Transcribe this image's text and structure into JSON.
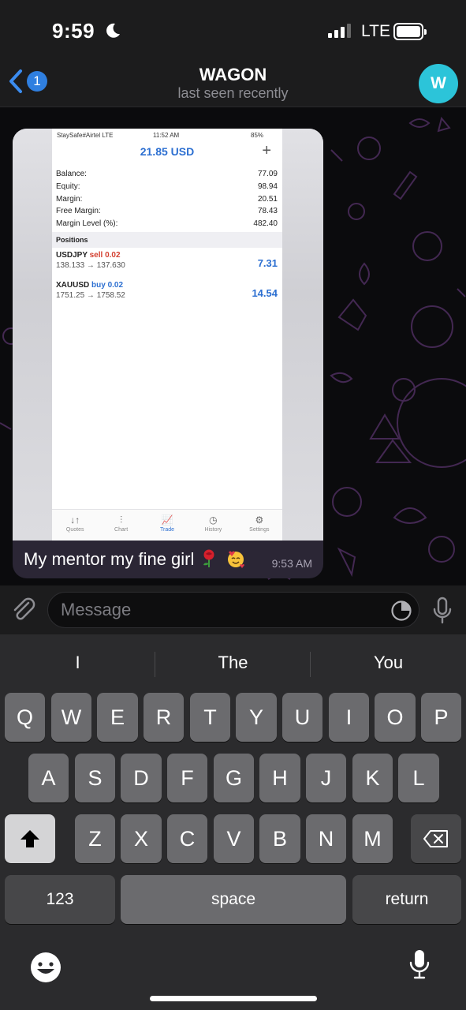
{
  "status_bar": {
    "time": "9:59",
    "network": "LTE",
    "icons": [
      "moon-icon",
      "signal-icon",
      "battery-icon"
    ]
  },
  "header": {
    "back_badge": "1",
    "title": "WAGON",
    "subtitle": "last seen recently",
    "avatar_letter": "W"
  },
  "message": {
    "caption": "My mentor my fine girl",
    "emojis": [
      "rose",
      "smiling-face-with-hearts"
    ],
    "time": "9:53 AM",
    "screenshot": {
      "status_left": "StaySafe#Airtel  LTE",
      "status_time": "11:52 AM",
      "status_battery": "85%",
      "title": "21.85 USD",
      "plus": "+",
      "account": [
        {
          "label": "Balance:",
          "value": "77.09"
        },
        {
          "label": "Equity:",
          "value": "98.94"
        },
        {
          "label": "Margin:",
          "value": "20.51"
        },
        {
          "label": "Free Margin:",
          "value": "78.43"
        },
        {
          "label": "Margin Level (%):",
          "value": "482.40"
        }
      ],
      "positions_header": "Positions",
      "positions": [
        {
          "symbol": "USDJPY",
          "direction": "sell 0.02",
          "prices": "138.133 → 137.630",
          "profit": "7.31"
        },
        {
          "symbol": "XAUUSD",
          "direction": "buy 0.02",
          "prices": "1751.25 → 1758.52",
          "profit": "14.54"
        }
      ],
      "tabs": [
        {
          "label": "Quotes",
          "icon": "↓↑"
        },
        {
          "label": "Chart",
          "icon": "⫶"
        },
        {
          "label": "Trade",
          "icon": "📈"
        },
        {
          "label": "History",
          "icon": "◷"
        },
        {
          "label": "Settings",
          "icon": "⚙"
        }
      ]
    }
  },
  "composer": {
    "placeholder": "Message"
  },
  "keyboard": {
    "suggestions": [
      "I",
      "The",
      "You"
    ],
    "row1": [
      "Q",
      "W",
      "E",
      "R",
      "T",
      "Y",
      "U",
      "I",
      "O",
      "P"
    ],
    "row2": [
      "A",
      "S",
      "D",
      "F",
      "G",
      "H",
      "J",
      "K",
      "L"
    ],
    "row3": [
      "Z",
      "X",
      "C",
      "V",
      "B",
      "N",
      "M"
    ],
    "numbers_label": "123",
    "space_label": "space",
    "return_label": "return"
  },
  "colors": {
    "accent": "#2f7fe0",
    "avatar": "#2cc4d9",
    "bubble": "#2b2635",
    "keyboard": "#2b2b2d",
    "key": "#6b6b6e"
  }
}
